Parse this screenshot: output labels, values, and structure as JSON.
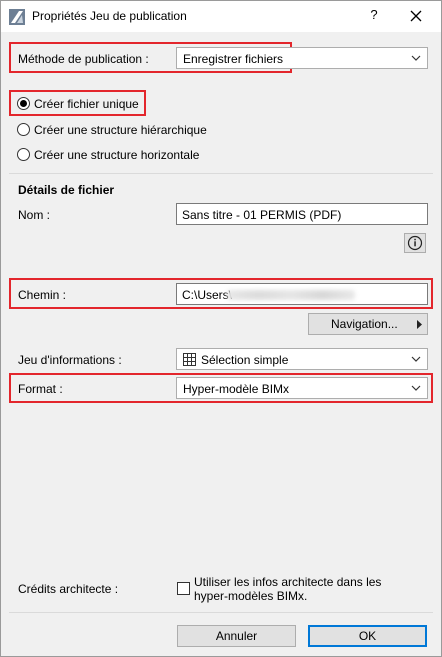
{
  "window": {
    "title": "Propriétés Jeu de publication",
    "help": "?",
    "close_icon": "close-icon"
  },
  "method": {
    "label": "Méthode de publication :",
    "value": "Enregistrer fichiers"
  },
  "options": [
    {
      "label": "Créer fichier unique",
      "checked": true
    },
    {
      "label": "Créer une structure hiérarchique",
      "checked": false
    },
    {
      "label": "Créer une structure horizontale",
      "checked": false
    }
  ],
  "details": {
    "heading": "Détails de fichier",
    "name_label": "Nom :",
    "name_value": "Sans titre - 01 PERMIS (PDF)",
    "info_icon": "info-icon",
    "path_label": "Chemin :",
    "path_value": "C:\\Users\\",
    "browse_label": "Navigation...",
    "info_set_label": "Jeu d'informations :",
    "info_set_value": "Sélection simple",
    "format_label": "Format :",
    "format_value": "Hyper-modèle BIMx"
  },
  "credits": {
    "label": "Crédits architecte :",
    "checkbox_line1": "Utiliser les infos architecte dans les",
    "checkbox_line2": "hyper-modèles BIMx.",
    "checked": false
  },
  "buttons": {
    "cancel": "Annuler",
    "ok": "OK"
  },
  "colors": {
    "highlight": "#e3262c",
    "accent": "#0078d7"
  }
}
